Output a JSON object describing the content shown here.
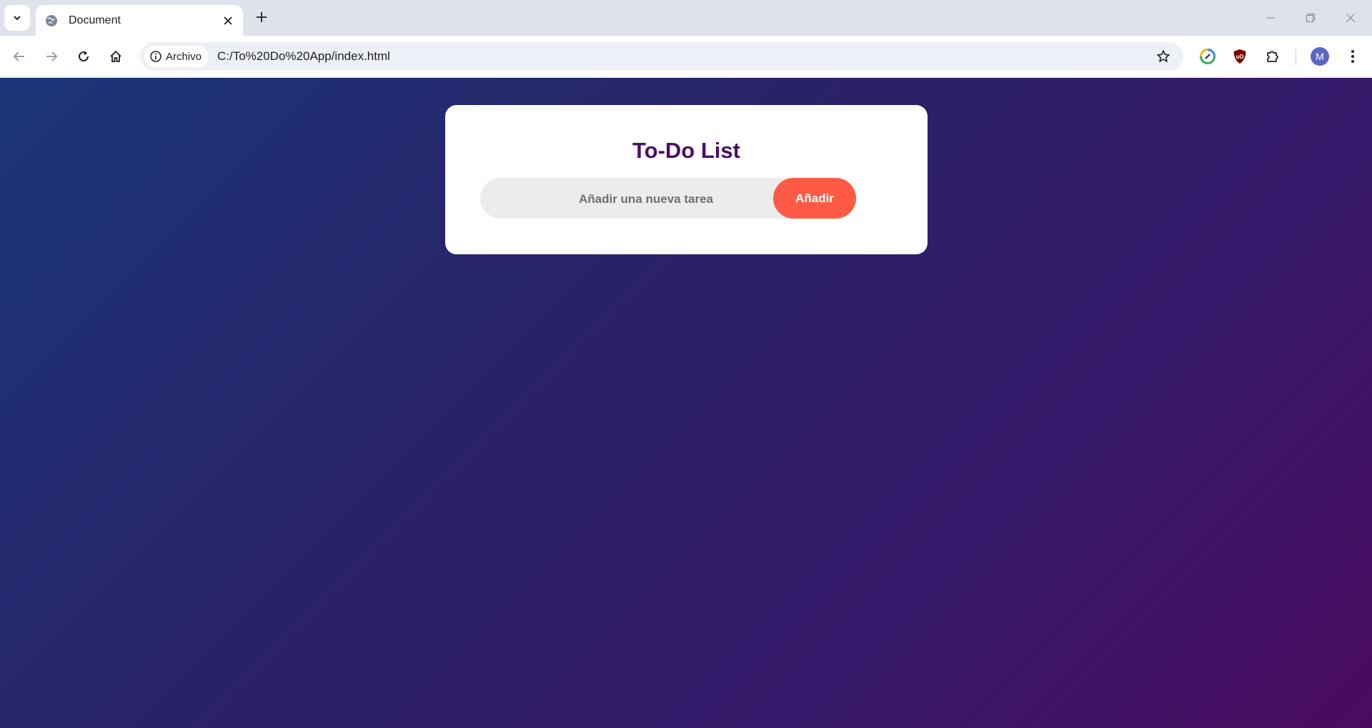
{
  "browser": {
    "tab": {
      "title": "Document",
      "favicon": "globe-icon"
    },
    "omnibox": {
      "site_chip_label": "Archivo",
      "url": "C:/To%20Do%20App/index.html"
    },
    "profile": {
      "initial": "M",
      "color": "#5b67c0"
    }
  },
  "page": {
    "title": "To-Do List",
    "input": {
      "placeholder": "Añadir una nueva tarea",
      "value": ""
    },
    "add_button_label": "Añadir"
  },
  "colors": {
    "title": "#4b0f66",
    "accent_button": "#ff5a45",
    "background_start": "#1a3578",
    "background_end": "#4a0b5e"
  }
}
